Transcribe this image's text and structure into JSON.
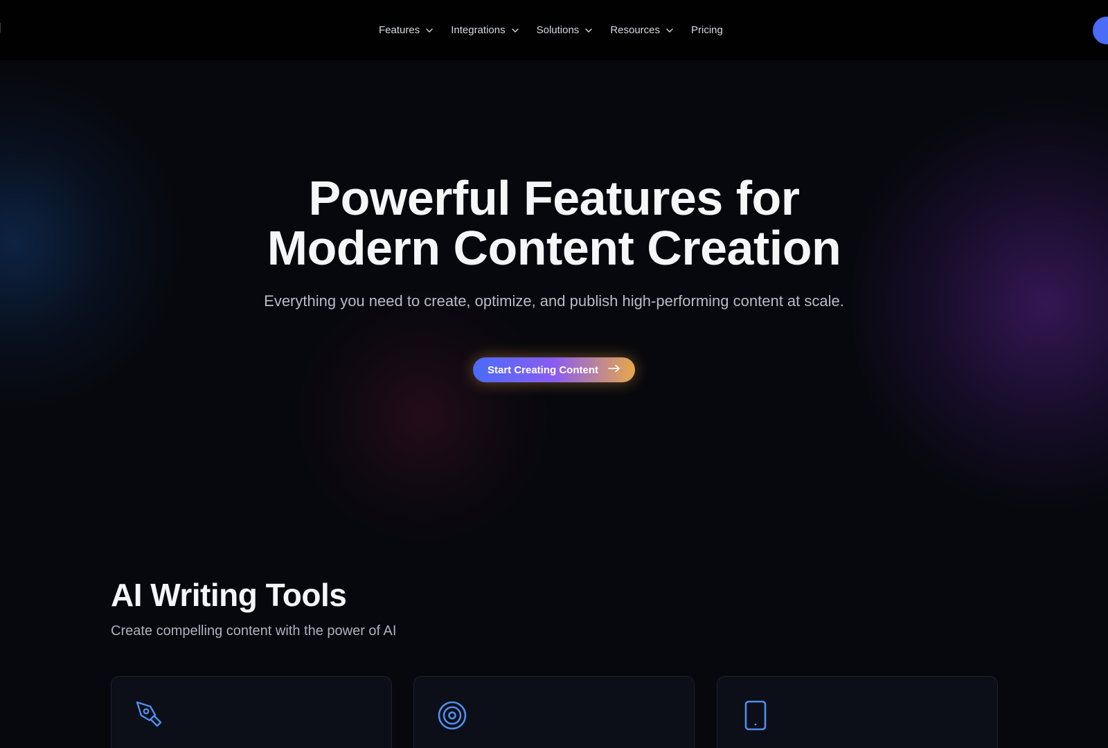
{
  "nav": {
    "logo_text": "I",
    "items": [
      {
        "label": "Features",
        "has_dropdown": true
      },
      {
        "label": "Integrations",
        "has_dropdown": true
      },
      {
        "label": "Solutions",
        "has_dropdown": true
      },
      {
        "label": "Resources",
        "has_dropdown": true
      },
      {
        "label": "Pricing",
        "has_dropdown": false
      }
    ],
    "chevron_icon": "chevron-down-icon"
  },
  "hero": {
    "title_line1": "Powerful Features for",
    "title_line2": "Modern Content Creation",
    "subtitle": "Everything you need to create, optimize, and publish high-performing content at scale.",
    "cta_label": "Start Creating Content",
    "cta_icon": "arrow-right-icon"
  },
  "section": {
    "title": "AI Writing Tools",
    "subtitle": "Create compelling content with the power of AI",
    "cards": [
      {
        "icon": "pen-tool-icon"
      },
      {
        "icon": "target-icon"
      },
      {
        "icon": "tablet-icon"
      }
    ]
  },
  "colors": {
    "background": "#07080d",
    "nav_background": "#010102",
    "accent_blue": "#4a6cf7",
    "accent_orange": "#e6a84a",
    "icon_blue": "#4f8ff0",
    "card_background": "#0c0f18"
  }
}
